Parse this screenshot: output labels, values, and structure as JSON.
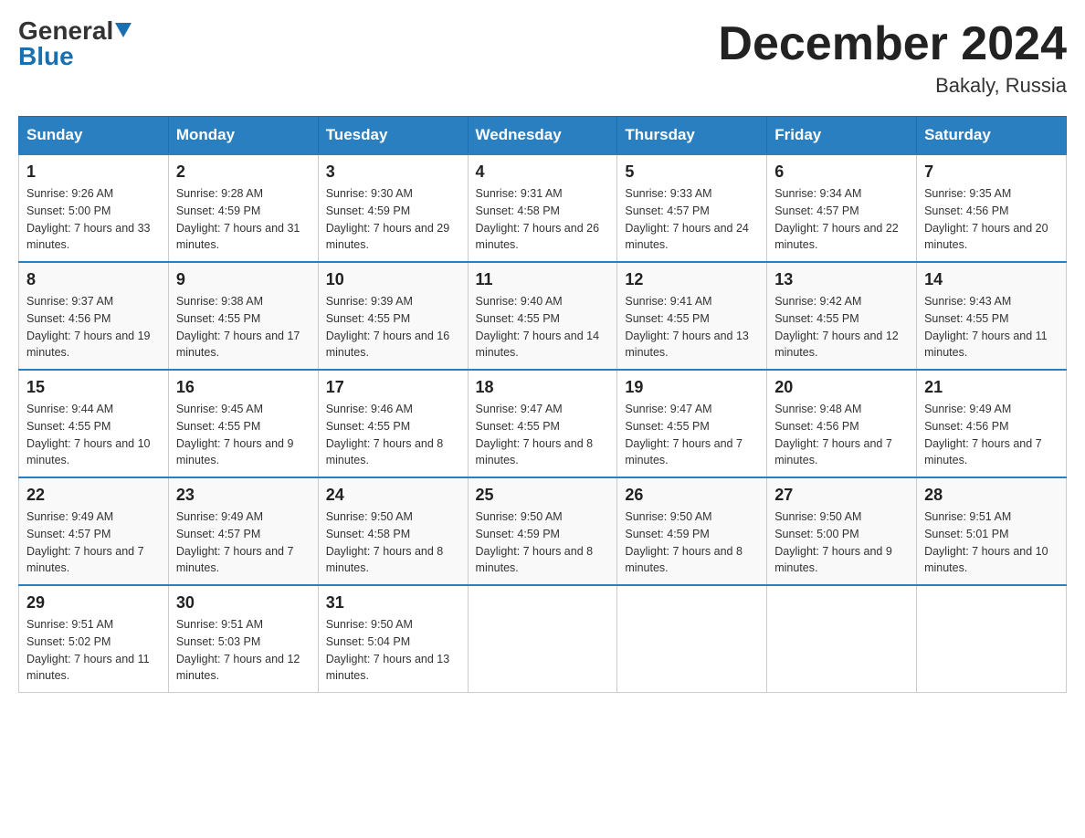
{
  "logo": {
    "general": "General",
    "blue": "Blue"
  },
  "header": {
    "month": "December 2024",
    "location": "Bakaly, Russia"
  },
  "days_of_week": [
    "Sunday",
    "Monday",
    "Tuesday",
    "Wednesday",
    "Thursday",
    "Friday",
    "Saturday"
  ],
  "weeks": [
    [
      {
        "day": "1",
        "sunrise": "9:26 AM",
        "sunset": "5:00 PM",
        "daylight": "7 hours and 33 minutes."
      },
      {
        "day": "2",
        "sunrise": "9:28 AM",
        "sunset": "4:59 PM",
        "daylight": "7 hours and 31 minutes."
      },
      {
        "day": "3",
        "sunrise": "9:30 AM",
        "sunset": "4:59 PM",
        "daylight": "7 hours and 29 minutes."
      },
      {
        "day": "4",
        "sunrise": "9:31 AM",
        "sunset": "4:58 PM",
        "daylight": "7 hours and 26 minutes."
      },
      {
        "day": "5",
        "sunrise": "9:33 AM",
        "sunset": "4:57 PM",
        "daylight": "7 hours and 24 minutes."
      },
      {
        "day": "6",
        "sunrise": "9:34 AM",
        "sunset": "4:57 PM",
        "daylight": "7 hours and 22 minutes."
      },
      {
        "day": "7",
        "sunrise": "9:35 AM",
        "sunset": "4:56 PM",
        "daylight": "7 hours and 20 minutes."
      }
    ],
    [
      {
        "day": "8",
        "sunrise": "9:37 AM",
        "sunset": "4:56 PM",
        "daylight": "7 hours and 19 minutes."
      },
      {
        "day": "9",
        "sunrise": "9:38 AM",
        "sunset": "4:55 PM",
        "daylight": "7 hours and 17 minutes."
      },
      {
        "day": "10",
        "sunrise": "9:39 AM",
        "sunset": "4:55 PM",
        "daylight": "7 hours and 16 minutes."
      },
      {
        "day": "11",
        "sunrise": "9:40 AM",
        "sunset": "4:55 PM",
        "daylight": "7 hours and 14 minutes."
      },
      {
        "day": "12",
        "sunrise": "9:41 AM",
        "sunset": "4:55 PM",
        "daylight": "7 hours and 13 minutes."
      },
      {
        "day": "13",
        "sunrise": "9:42 AM",
        "sunset": "4:55 PM",
        "daylight": "7 hours and 12 minutes."
      },
      {
        "day": "14",
        "sunrise": "9:43 AM",
        "sunset": "4:55 PM",
        "daylight": "7 hours and 11 minutes."
      }
    ],
    [
      {
        "day": "15",
        "sunrise": "9:44 AM",
        "sunset": "4:55 PM",
        "daylight": "7 hours and 10 minutes."
      },
      {
        "day": "16",
        "sunrise": "9:45 AM",
        "sunset": "4:55 PM",
        "daylight": "7 hours and 9 minutes."
      },
      {
        "day": "17",
        "sunrise": "9:46 AM",
        "sunset": "4:55 PM",
        "daylight": "7 hours and 8 minutes."
      },
      {
        "day": "18",
        "sunrise": "9:47 AM",
        "sunset": "4:55 PM",
        "daylight": "7 hours and 8 minutes."
      },
      {
        "day": "19",
        "sunrise": "9:47 AM",
        "sunset": "4:55 PM",
        "daylight": "7 hours and 7 minutes."
      },
      {
        "day": "20",
        "sunrise": "9:48 AM",
        "sunset": "4:56 PM",
        "daylight": "7 hours and 7 minutes."
      },
      {
        "day": "21",
        "sunrise": "9:49 AM",
        "sunset": "4:56 PM",
        "daylight": "7 hours and 7 minutes."
      }
    ],
    [
      {
        "day": "22",
        "sunrise": "9:49 AM",
        "sunset": "4:57 PM",
        "daylight": "7 hours and 7 minutes."
      },
      {
        "day": "23",
        "sunrise": "9:49 AM",
        "sunset": "4:57 PM",
        "daylight": "7 hours and 7 minutes."
      },
      {
        "day": "24",
        "sunrise": "9:50 AM",
        "sunset": "4:58 PM",
        "daylight": "7 hours and 8 minutes."
      },
      {
        "day": "25",
        "sunrise": "9:50 AM",
        "sunset": "4:59 PM",
        "daylight": "7 hours and 8 minutes."
      },
      {
        "day": "26",
        "sunrise": "9:50 AM",
        "sunset": "4:59 PM",
        "daylight": "7 hours and 8 minutes."
      },
      {
        "day": "27",
        "sunrise": "9:50 AM",
        "sunset": "5:00 PM",
        "daylight": "7 hours and 9 minutes."
      },
      {
        "day": "28",
        "sunrise": "9:51 AM",
        "sunset": "5:01 PM",
        "daylight": "7 hours and 10 minutes."
      }
    ],
    [
      {
        "day": "29",
        "sunrise": "9:51 AM",
        "sunset": "5:02 PM",
        "daylight": "7 hours and 11 minutes."
      },
      {
        "day": "30",
        "sunrise": "9:51 AM",
        "sunset": "5:03 PM",
        "daylight": "7 hours and 12 minutes."
      },
      {
        "day": "31",
        "sunrise": "9:50 AM",
        "sunset": "5:04 PM",
        "daylight": "7 hours and 13 minutes."
      },
      null,
      null,
      null,
      null
    ]
  ],
  "labels": {
    "sunrise": "Sunrise:",
    "sunset": "Sunset:",
    "daylight": "Daylight:"
  }
}
